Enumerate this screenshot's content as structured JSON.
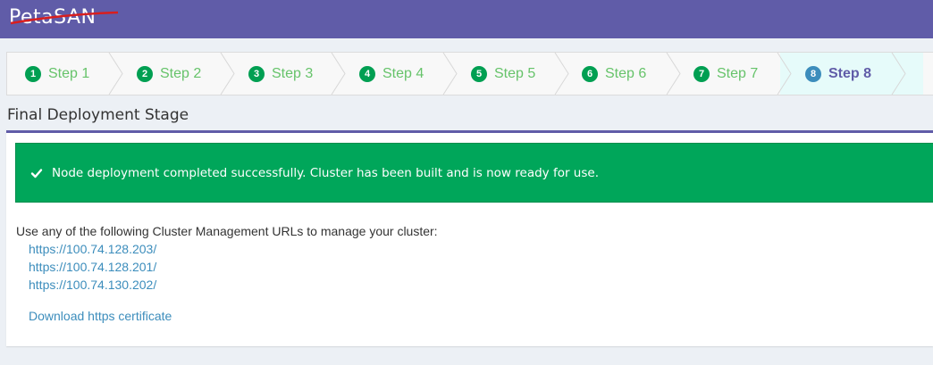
{
  "app": {
    "logo_text": "PetaSAN"
  },
  "wizard": {
    "steps": [
      {
        "num": "1",
        "label": "Step 1"
      },
      {
        "num": "2",
        "label": "Step 2"
      },
      {
        "num": "3",
        "label": "Step 3"
      },
      {
        "num": "4",
        "label": "Step 4"
      },
      {
        "num": "5",
        "label": "Step 5"
      },
      {
        "num": "6",
        "label": "Step 6"
      },
      {
        "num": "7",
        "label": "Step 7"
      },
      {
        "num": "8",
        "label": "Step 8"
      }
    ],
    "active_step": "8"
  },
  "page": {
    "title": "Final Deployment Stage",
    "alert_message": "Node deployment completed successfully. Cluster has been built and is now ready for use.",
    "intro": "Use any of the following Cluster Management URLs to manage your cluster:",
    "urls": [
      "https://100.74.128.203/",
      "https://100.74.128.201/",
      "https://100.74.130.202/"
    ],
    "download_label": "Download https certificate"
  },
  "colors": {
    "header": "#605ca8",
    "step_badge": "#009f52",
    "step_label": "#66c36a",
    "active_badge": "#3c8dbc",
    "active_bg": "#e6fbfa",
    "success": "#00a65a",
    "link": "#3c8dbc"
  },
  "icons": {
    "alert": "check-icon"
  }
}
